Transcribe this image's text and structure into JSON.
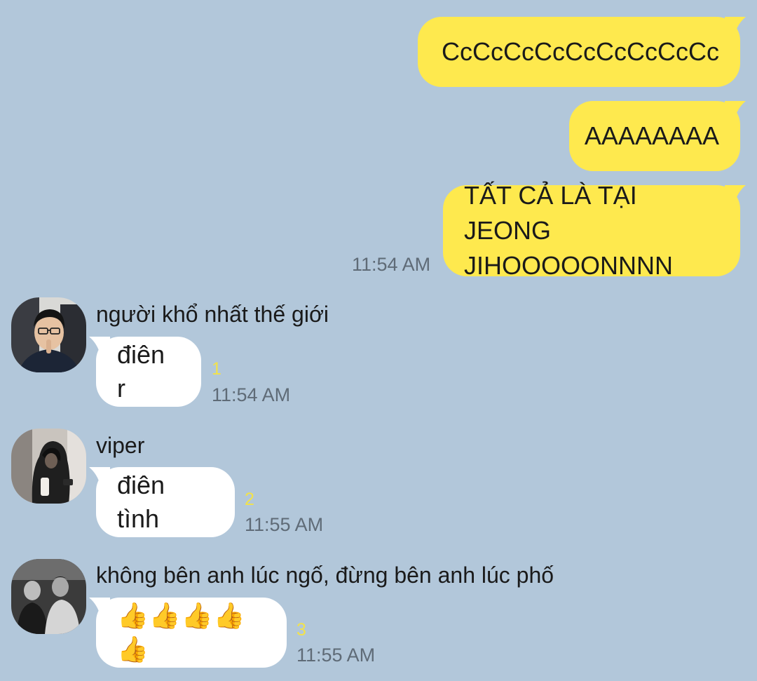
{
  "outgoing": [
    {
      "text": "CcCcCcCcCcCcCcCcCc"
    },
    {
      "text": "AAAAAAAA"
    },
    {
      "line1": "TẤT CẢ LÀ TẠI JEONG",
      "line2": "JIHOOOOONNNN",
      "time": "11:54 AM"
    }
  ],
  "incoming": [
    {
      "sender": "người khổ nhất thế giới",
      "text": "điên r",
      "unread": "1",
      "time": "11:54 AM",
      "avatar_icon": "avatar-glasses-boy-photo"
    },
    {
      "sender": "viper",
      "text": "điên tình",
      "unread": "2",
      "time": "11:55 AM",
      "avatar_icon": "avatar-hooded-person-photo"
    },
    {
      "sender": "không bên anh lúc ngố, đừng bên anh lúc phố",
      "text": "👍👍👍👍👍",
      "unread": "3",
      "time": "11:55 AM",
      "avatar_icon": "avatar-group-photo"
    }
  ],
  "colors": {
    "background": "#B2C7DA",
    "outgoing_bubble": "#FEE94E",
    "incoming_bubble": "#FFFFFF",
    "unread_count": "#F2E24A",
    "timestamp": "#5f6b77"
  }
}
